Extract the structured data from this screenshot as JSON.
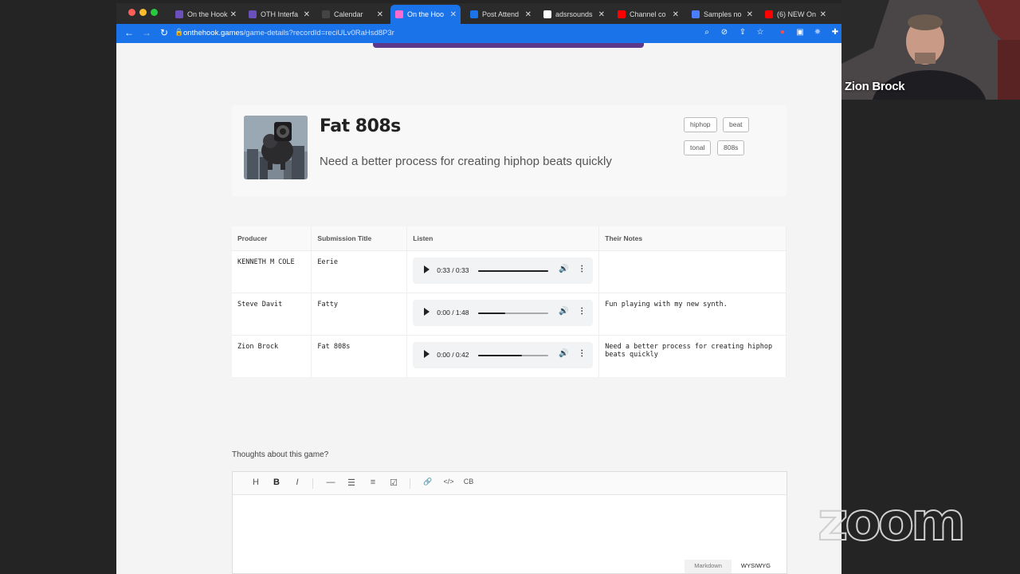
{
  "browser": {
    "tabs": [
      {
        "label": "On the Hook",
        "active": false,
        "fav": "#6b4fbb"
      },
      {
        "label": "OTH Interfa",
        "active": false,
        "fav": "#6b4fbb"
      },
      {
        "label": "Calendar",
        "active": false,
        "fav": "#444"
      },
      {
        "label": "On the Hoo",
        "active": true,
        "fav": "#ff6bd0"
      },
      {
        "label": "Post Attend",
        "active": false,
        "fav": "#1a73e8"
      },
      {
        "label": "adsrsounds",
        "active": false,
        "fav": "#ffffff"
      },
      {
        "label": "Channel co",
        "active": false,
        "fav": "#ff0000"
      },
      {
        "label": "Samples no",
        "active": false,
        "fav": "#4a7dff"
      },
      {
        "label": "(6) NEW On",
        "active": false,
        "fav": "#ff0000"
      }
    ],
    "url_domain": "onthehook.games",
    "url_path": "/game-details?recordId=reciULv0RaHsd8P3r"
  },
  "game": {
    "title": "Fat 808s",
    "description": "Need a better process for creating hiphop beats quickly",
    "tags": [
      "hiphop",
      "beat",
      "tonal",
      "808s"
    ]
  },
  "table": {
    "headers": [
      "Producer",
      "Submission Title",
      "Listen",
      "Their Notes"
    ],
    "rows": [
      {
        "producer": "KENNETH M COLE",
        "title": "Eerie",
        "time": "0:33 / 0:33",
        "progress": 1.0,
        "notes": ""
      },
      {
        "producer": "Steve Davit",
        "title": "Fatty",
        "time": "0:00 / 1:48",
        "progress": 0.39,
        "notes": "Fun playing with my new synth."
      },
      {
        "producer": "Zion Brock",
        "title": "Fat 808s",
        "time": "0:00 / 0:42",
        "progress": 0.62,
        "notes": "Need a better process for creating hiphop beats quickly"
      }
    ]
  },
  "editor": {
    "label": "Thoughts about this game?",
    "toolbar": [
      "H",
      "B",
      "I",
      "—",
      "☰",
      "≡",
      "☑",
      "🔗",
      "</>",
      "CB"
    ],
    "modes": [
      "Markdown",
      "WYSIWYG"
    ]
  },
  "zoom": {
    "participant_name": "Zion Brock",
    "logo": "zoom"
  }
}
